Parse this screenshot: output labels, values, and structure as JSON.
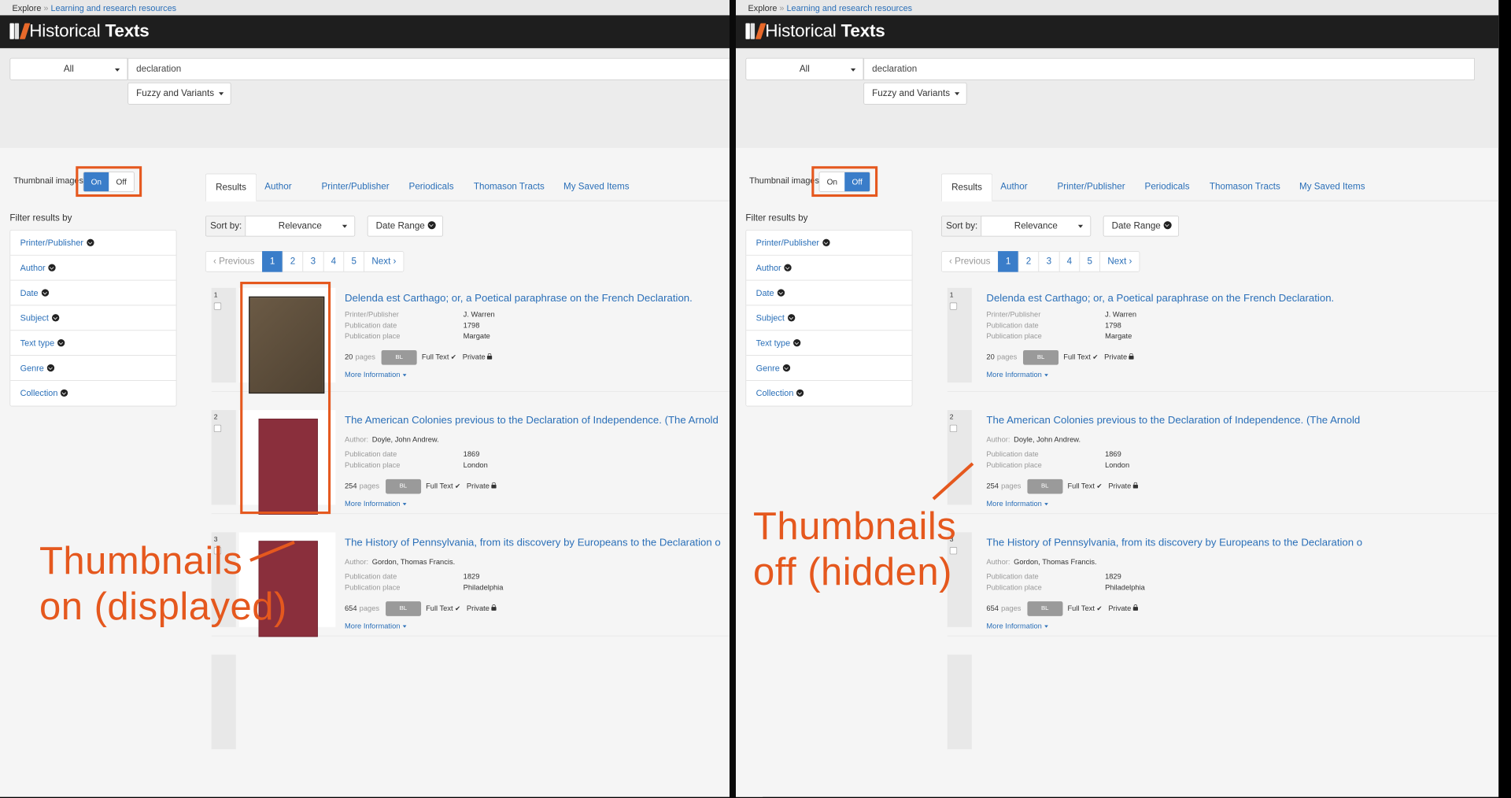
{
  "breadcrumb": {
    "root": "Explore",
    "sep": " » ",
    "current": "Learning and research resources"
  },
  "logo": {
    "light": "Historical ",
    "bold": "Texts"
  },
  "search": {
    "scope": "All",
    "query": "declaration",
    "mode": "Fuzzy and Variants"
  },
  "thumbnail_toggle": {
    "label": "Thumbnail images:",
    "on": "On",
    "off": "Off"
  },
  "filters": {
    "title": "Filter results by",
    "items": [
      "Printer/Publisher",
      "Author",
      "Date",
      "Subject",
      "Text type",
      "Genre",
      "Collection"
    ]
  },
  "tabs": [
    "Results",
    "Author",
    "Printer/Publisher",
    "Periodicals",
    "Thomason Tracts",
    "My Saved Items"
  ],
  "sort": {
    "label": "Sort by:",
    "value": "Relevance",
    "date_range": "Date Range"
  },
  "pagination": [
    "‹ Previous",
    "1",
    "2",
    "3",
    "4",
    "5",
    "Next ›"
  ],
  "results": [
    {
      "num": "1",
      "title": "Delenda est Carthago; or, a Poetical paraphrase on the French Declaration.",
      "meta": [
        [
          "Printer/Publisher",
          "J. Warren"
        ],
        [
          "Publication date",
          "1798"
        ],
        [
          "Publication place",
          "Margate"
        ]
      ],
      "pages": "20",
      "badge": "BL",
      "full_text": "Full Text",
      "private": "Private",
      "more": "More Information"
    },
    {
      "num": "2",
      "title": "The American Colonies previous to the Declaration of Independence. (The Arnold",
      "author": [
        "Author:",
        "Doyle, John Andrew."
      ],
      "meta": [
        [
          "Publication date",
          "1869"
        ],
        [
          "Publication place",
          "London"
        ]
      ],
      "pages": "254",
      "badge": "BL",
      "full_text": "Full Text",
      "private": "Private",
      "more": "More Information"
    },
    {
      "num": "3",
      "title": "The History of Pennsylvania, from its discovery by Europeans to the Declaration o",
      "author": [
        "Author:",
        "Gordon, Thomas Francis."
      ],
      "meta": [
        [
          "Publication date",
          "1829"
        ],
        [
          "Publication place",
          "Philadelphia"
        ]
      ],
      "pages": "654",
      "badge": "BL",
      "full_text": "Full Text",
      "private": "Private",
      "more": "More Information"
    }
  ],
  "pages_word": "pages",
  "annotations": {
    "left": [
      "Thumbnails",
      "on (displayed)"
    ],
    "right": [
      "Thumbnails",
      "off (hidden)"
    ]
  },
  "colors": {
    "accent": "#e5581e",
    "link": "#2a6fb8",
    "primary": "#3a7dc9",
    "header": "#1e1e1e",
    "book_cover": "#8a2f3c",
    "book_cover_dark": "#5a4a3a"
  },
  "icons": [
    "chevron-circle-icon",
    "caret-down-icon",
    "checkmark-icon",
    "lock-icon",
    "logo-icon"
  ]
}
